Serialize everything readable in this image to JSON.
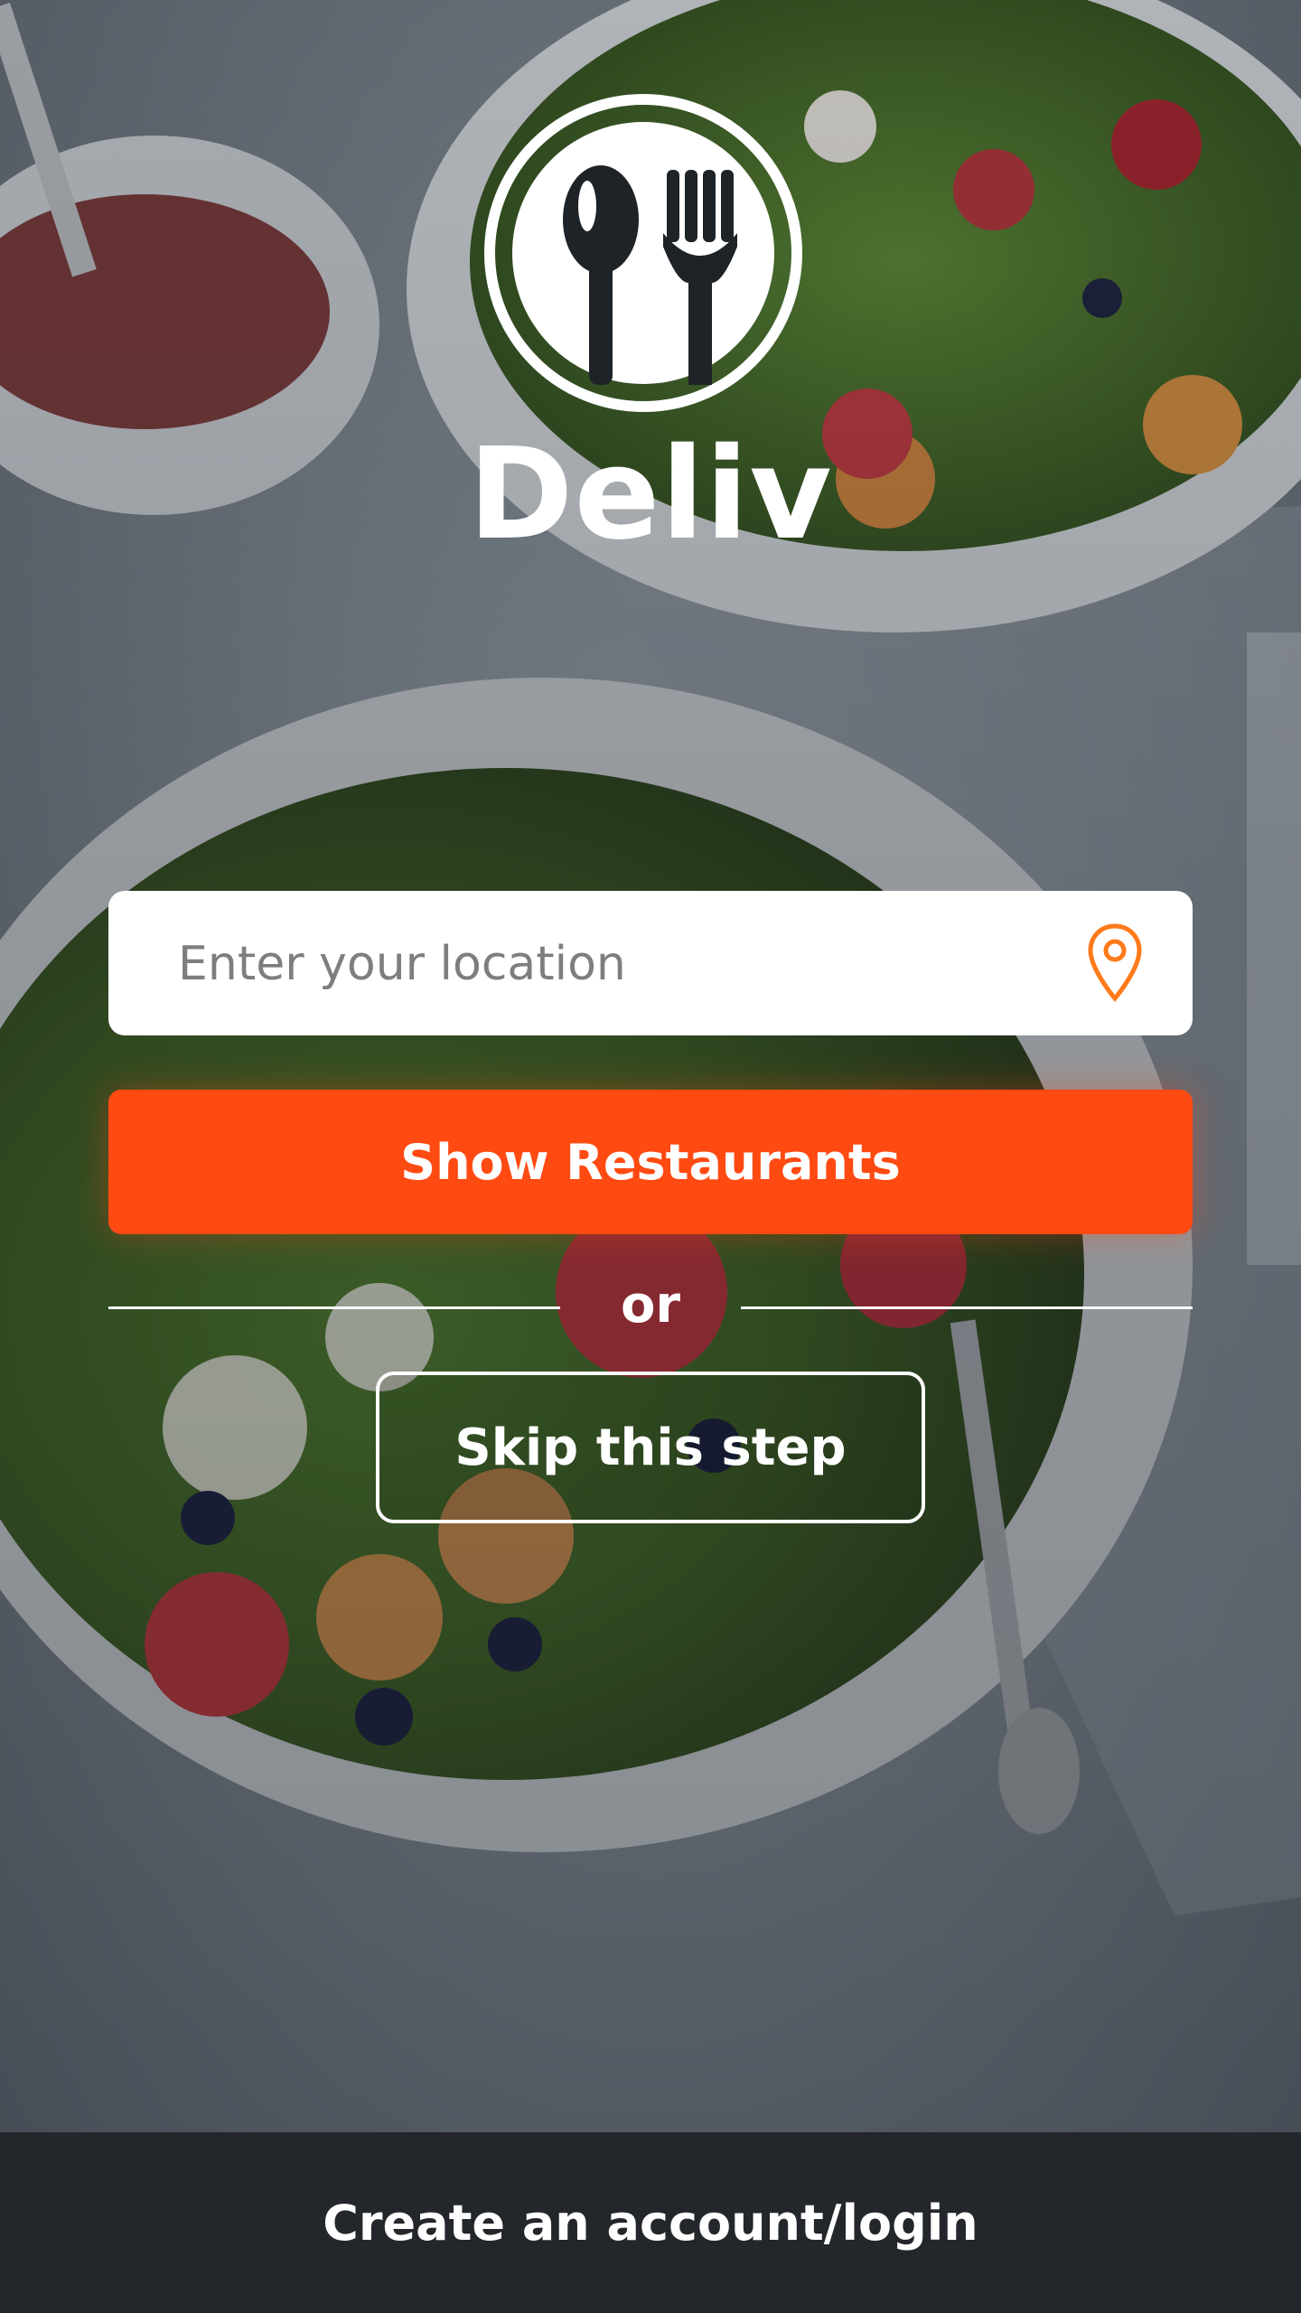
{
  "app": {
    "brand_name": "Deliv",
    "logo_icon": "spoon-fork-icon"
  },
  "location": {
    "placeholder": "Enter your location",
    "value": "",
    "icon": "location-pin-icon"
  },
  "actions": {
    "show_restaurants": "Show Restaurants",
    "divider_text": "or",
    "skip": "Skip this step"
  },
  "footer": {
    "account_link": "Create an account/login"
  },
  "colors": {
    "accent": "#ff4a12",
    "footer_bg": "#23262b",
    "pin_icon": "#ff7a1a"
  },
  "background": {
    "icon": "salad-food-photo"
  }
}
